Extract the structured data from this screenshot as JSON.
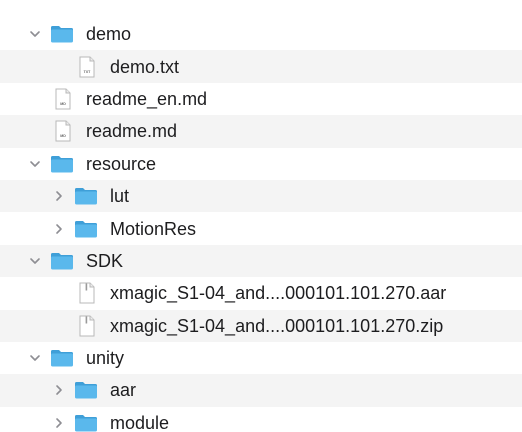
{
  "items": [
    {
      "name": "demo",
      "kind": "folder",
      "depth": 0,
      "state": "expanded"
    },
    {
      "name": "demo.txt",
      "kind": "file",
      "depth": 1,
      "badge": "TXT"
    },
    {
      "name": "readme_en.md",
      "kind": "file",
      "depth": 0,
      "badge": "MD"
    },
    {
      "name": "readme.md",
      "kind": "file",
      "depth": 0,
      "badge": "MD"
    },
    {
      "name": "resource",
      "kind": "folder",
      "depth": 0,
      "state": "expanded"
    },
    {
      "name": "lut",
      "kind": "folder",
      "depth": 1,
      "state": "collapsed"
    },
    {
      "name": "MotionRes",
      "kind": "folder",
      "depth": 1,
      "state": "collapsed"
    },
    {
      "name": "SDK",
      "kind": "folder",
      "depth": 0,
      "state": "expanded"
    },
    {
      "name": "xmagic_S1-04_and....000101.101.270.aar",
      "kind": "archive",
      "depth": 1
    },
    {
      "name": "xmagic_S1-04_and....000101.101.270.zip",
      "kind": "archive",
      "depth": 1
    },
    {
      "name": "unity",
      "kind": "folder",
      "depth": 0,
      "state": "expanded"
    },
    {
      "name": "aar",
      "kind": "folder",
      "depth": 1,
      "state": "collapsed"
    },
    {
      "name": "module",
      "kind": "folder",
      "depth": 1,
      "state": "collapsed"
    }
  ],
  "colors": {
    "folder_body": "#5ab8ec",
    "folder_tab": "#3f9fd8",
    "disclosure": "#8e8e93",
    "stripe": "#f4f4f4",
    "text": "#1d1d1f"
  }
}
